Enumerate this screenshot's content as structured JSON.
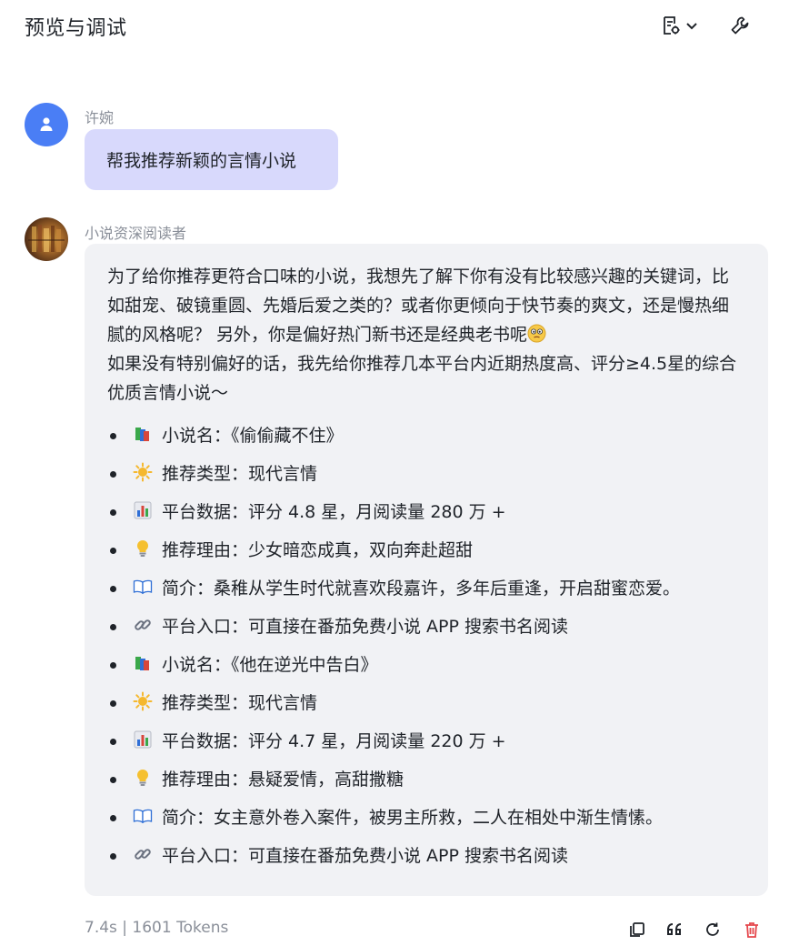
{
  "header": {
    "title": "预览与调试"
  },
  "user_message": {
    "sender": "许婉",
    "text": "帮我推荐新颖的言情小说"
  },
  "bot_message": {
    "sender": "小说资深阅读者",
    "intro_1": "为了给你推荐更符合口味的小说，我想先了解下你有没有比较感兴趣的关键词，比如甜宠、破镜重圆、先婚后爱之类的？或者你更倾向于快节奏的爽文，还是慢热细腻的风格呢？ 另外，你是偏好热门新书还是经典老书呢",
    "intro_2": "如果没有特别偏好的话，我先给你推荐几本平台内近期热度高、评分≥4.5星的综合优质言情小说～",
    "items": [
      {
        "icon": "books-icon",
        "text": "小说名：《偷偷藏不住》"
      },
      {
        "icon": "sun-icon",
        "text": "推荐类型：现代言情"
      },
      {
        "icon": "bar-chart-icon",
        "text": "平台数据：评分 4.8 星，月阅读量 280 万 +"
      },
      {
        "icon": "lightbulb-icon",
        "text": "推荐理由：少女暗恋成真，双向奔赴超甜"
      },
      {
        "icon": "open-book-icon",
        "text": "简介：桑稚从学生时代就喜欢段嘉许，多年后重逢，开启甜蜜恋爱。"
      },
      {
        "icon": "link-icon",
        "text": "平台入口：可直接在番茄免费小说 APP 搜索书名阅读"
      },
      {
        "icon": "books-icon",
        "text": "小说名：《他在逆光中告白》"
      },
      {
        "icon": "sun-icon",
        "text": "推荐类型：现代言情"
      },
      {
        "icon": "bar-chart-icon",
        "text": "平台数据：评分 4.7 星，月阅读量 220 万 +"
      },
      {
        "icon": "lightbulb-icon",
        "text": "推荐理由：悬疑爱情，高甜撒糖"
      },
      {
        "icon": "open-book-icon",
        "text": "简介：女主意外卷入案件，被男主所救，二人在相处中渐生情愫。"
      },
      {
        "icon": "link-icon",
        "text": "平台入口：可直接在番茄免费小说 APP 搜索书名阅读"
      }
    ]
  },
  "footer": {
    "stats": "7.4s | 1601 Tokens"
  },
  "colors": {
    "user_bubble": "#d8d9fc",
    "bot_bubble": "#f1f2f5",
    "user_avatar": "#4a7ef5",
    "delete_icon": "#e5484d"
  }
}
